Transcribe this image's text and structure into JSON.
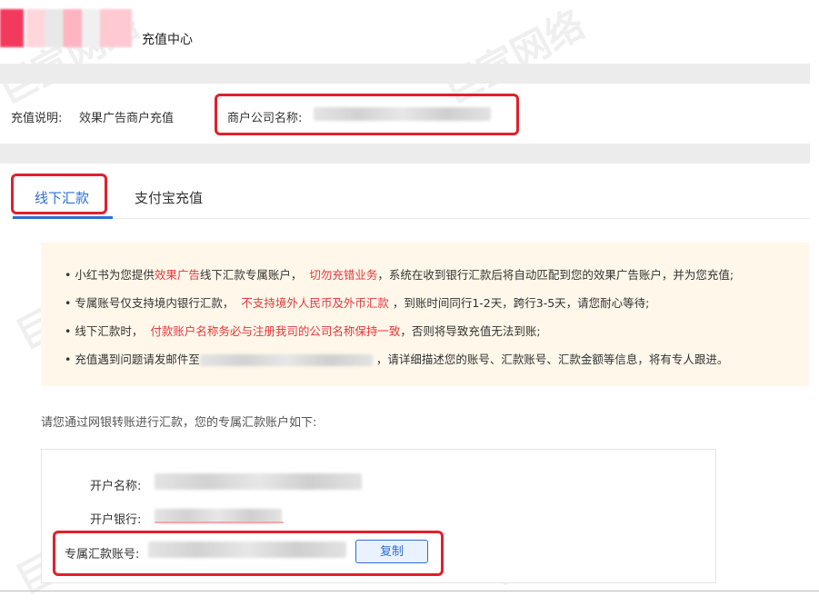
{
  "header": {
    "title": "充值中心"
  },
  "info": {
    "desc_label": "充值说明:",
    "desc_value": "效果广告商户充值",
    "company_label": "商户公司名称:"
  },
  "tabs": [
    {
      "label": "线下汇款",
      "active": true
    },
    {
      "label": "支付宝充值",
      "active": false
    }
  ],
  "notice": {
    "items": [
      {
        "parts": [
          "小红书为您提供",
          "效果广告",
          "线下汇款专属账户，",
          "切勿充错业务",
          "，系统在收到银行汇款后将自动匹配到您的效果广告账户，并为您充值;"
        ]
      },
      {
        "parts": [
          "专属账号仅支持境内银行汇款，",
          "不支持境外人民币及外币汇款",
          "，到账时间同行1-2天，跨行3-5天，请您耐心等待;"
        ]
      },
      {
        "parts": [
          "线下汇款时，",
          "付款账户名称务必与注册我司的公司名称保持一致",
          "，否则将导致充值无法到账;"
        ]
      },
      {
        "parts": [
          "充值遇到问题请发邮件至",
          "，请详细描述您的账号、汇款账号、汇款金额等信息，将有专人跟进。"
        ]
      }
    ]
  },
  "account": {
    "intro": "请您通过网银转账进行汇款，您的专属汇款账户如下:",
    "name_label": "开户名称:",
    "bank_label": "开户银行:",
    "number_label": "专属汇款账号:",
    "copy_label": "复制"
  },
  "watermark": "巨宣网络",
  "colors": {
    "accent": "#2d6fd3",
    "highlight": "#e5383b",
    "annotation": "#e0202a",
    "notice_bg": "#fff7ea"
  }
}
